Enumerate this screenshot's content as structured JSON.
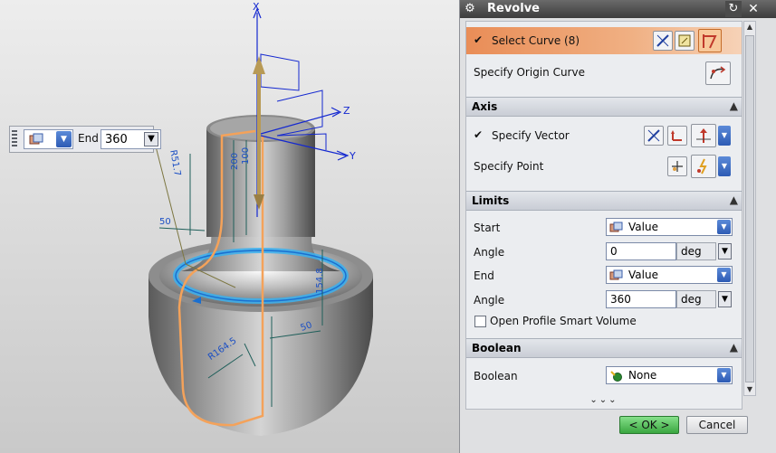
{
  "dialog": {
    "title": "Revolve",
    "sections": {
      "section": {
        "select_curve": "Select Curve (8)",
        "specify_origin_curve": "Specify Origin Curve"
      },
      "axis": {
        "header": "Axis",
        "specify_vector": "Specify Vector",
        "specify_point": "Specify Point"
      },
      "limits": {
        "header": "Limits",
        "start_label": "Start",
        "start_value": "Value",
        "start_angle_label": "Angle",
        "start_angle": "0",
        "end_label": "End",
        "end_value": "Value",
        "end_angle_label": "Angle",
        "end_angle": "360",
        "unit": "deg",
        "open_profile_label": "Open Profile Smart Volume",
        "open_profile_checked": false
      },
      "boolean": {
        "header": "Boolean",
        "label": "Boolean",
        "value": "None"
      }
    },
    "ok_label": "< OK >",
    "cancel_label": "Cancel"
  },
  "floating_input": {
    "label": "End",
    "value": "360"
  },
  "viewport": {
    "axis_labels": {
      "x": "X",
      "y": "Y",
      "z": "Z"
    },
    "dimensions": [
      "R51.7",
      "200",
      "100",
      "50",
      "154.8",
      "50",
      "R164.5"
    ]
  },
  "colors": {
    "accent_orange": "#e98d57",
    "ok_green": "#3aa640",
    "axis_blue": "#1428d0",
    "dimension_teal": "#1f5f5a"
  }
}
